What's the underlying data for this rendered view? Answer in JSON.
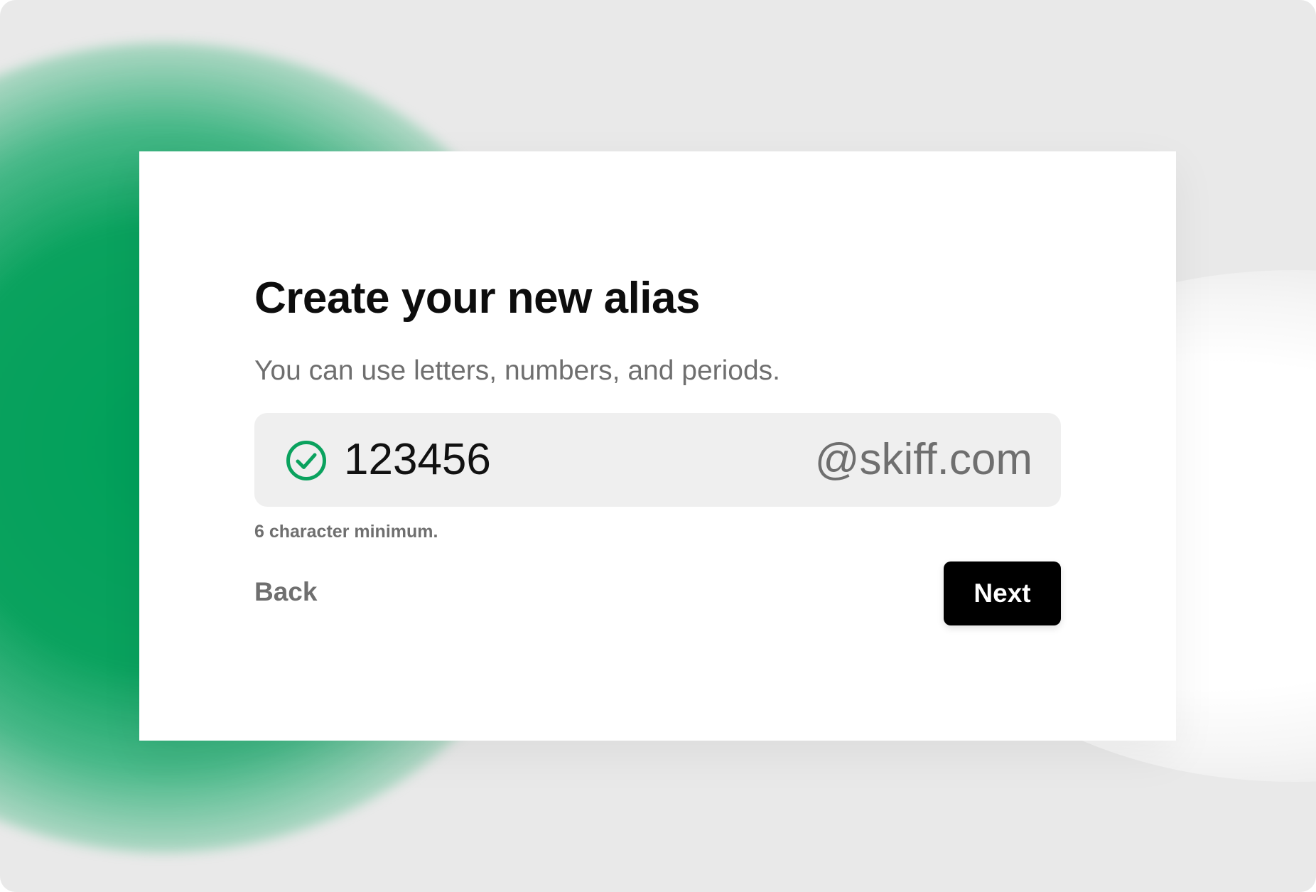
{
  "dialog": {
    "title": "Create your new alias",
    "subtitle": "You can use letters, numbers, and periods.",
    "alias_input": {
      "value": "123456",
      "domain_suffix": "@skiff.com",
      "status_icon": "check-circle-icon",
      "valid": true
    },
    "hint": "6 character minimum.",
    "back_label": "Back",
    "next_label": "Next"
  },
  "colors": {
    "accent_green": "#0aa25e",
    "button_bg": "#000000",
    "field_bg": "#efefef",
    "muted_text": "#6f6f6f"
  }
}
